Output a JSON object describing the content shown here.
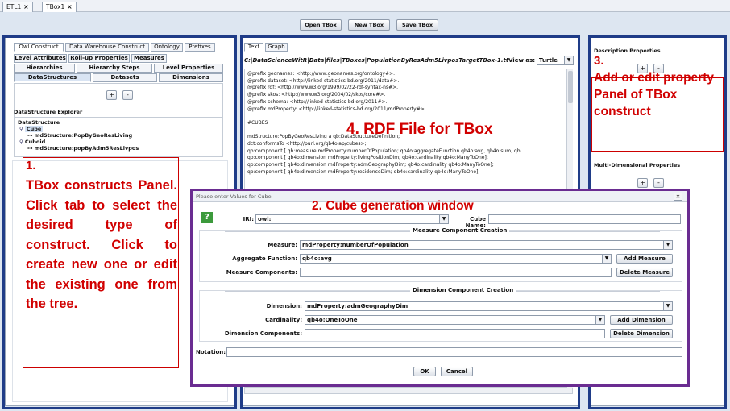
{
  "file_tabs": [
    {
      "label": "ETL1",
      "close": "×"
    },
    {
      "label": "TBox1",
      "close": "×"
    }
  ],
  "toolbar": {
    "open_label": "Open TBox",
    "new_label": "New TBox",
    "save_label": "Save TBox"
  },
  "left_panel": {
    "tabs_row1": [
      "Owl Construct",
      "Data Warehouse Construct",
      "Ontology",
      "Prefixes"
    ],
    "tabs_row2": [
      "Level Attributes",
      "Roll-up Properties",
      "Measures"
    ],
    "tabs_row3": [
      "Hierarchies",
      "Hierarchy Steps",
      "Level Properties"
    ],
    "tabs_row4": [
      "DataStructures",
      "Datasets",
      "Dimensions"
    ],
    "add_label": "+",
    "remove_label": "-",
    "explorer_title": "DataStructure Explorer",
    "tree": {
      "root": "DataStructure",
      "cube": "Cube",
      "cube_child": "mdStructure:PopByGeoResLiving",
      "cuboid": "Cuboid",
      "cuboid_child": "mdStructure:popByAdm5ResLivpos"
    }
  },
  "annotations": {
    "a1_num": "1.",
    "a1_text": "TBox constructs Panel. Click tab to select the desired type of construct. Click to create new one or edit the existing one from the tree.",
    "a2": "2. Cube generation window",
    "a3_num": "3.",
    "a3_text": "Add or edit property Panel of TBox construct",
    "a4": "4. RDF File for TBox"
  },
  "center_panel": {
    "tabs": [
      "Text",
      "Graph"
    ],
    "path": "C:|DataScienceWitR|Data|files|TBoxes|PopulationByResAdm5LivposTargetTBox-1.tt",
    "view_as_label": "View as:",
    "view_as_value": "Turtle",
    "lines": [
      "@prefix geonames: <http://www.geonames.org/ontology#>.",
      "@prefix dataset: <http://linked-statistics-bd.org/2011/data#>.",
      "@prefix rdf: <http://www.w3.org/1999/02/22-rdf-syntax-ns#>.",
      "@prefix skos: <http://www.w3.org/2004/02/skos/core#>.",
      "@prefix schema: <http://linked-statistics-bd.org/2011#>.",
      "@prefix mdProperty: <http://linked-statistics-bd.org/2011/mdProperty#>.",
      "",
      "#CUBES",
      "",
      "mdStructure:PopByGeoResLiving a qb:DataStructureDefinition;",
      "                                    dct:conformsTo <http://purl.org/qb4olap/cubes>;",
      "                                    qb:component [ qb:measure mdProperty:numberOfPopulation; qb4o:aggregateFunction qb4o:avg, qb4o:sum, qb",
      "                                    qb:component [ qb4o:dimension mdProperty:livingPositionDim; qb4o:cardinality qb4o:ManyToOne];",
      "                                    qb:component [ qb4o:dimension mdProperty:admGeographyDim; qb4o:cardinality qb4o:ManyToOne];",
      "                                    qb:component [ qb4o:dimension mdProperty:residenceDim; qb4o:cardinality qb4o:ManyToOne];"
    ]
  },
  "right_panel": {
    "desc_title": "Description Properties",
    "md_title": "Multi-Dimensional Properties",
    "add_label": "+",
    "remove_label": "-"
  },
  "dialog": {
    "title": "Please enter Values for Cube",
    "help_icon": "?",
    "close_icon": "✕",
    "iri_label": "IRI:",
    "iri_value": "owl:",
    "cube_name_label": "Cube Name:",
    "cube_name_value": "",
    "measure_section": "Measure Component Creation",
    "measure_label": "Measure:",
    "measure_value": "mdProperty:numberOfPopulation",
    "aggregate_label": "Aggregate Function:",
    "aggregate_value": "qb4o:avg",
    "add_measure_label": "Add Measure",
    "measure_components_label": "Measure Components:",
    "delete_measure_label": "Delete Measure",
    "dimension_section": "Dimension Component Creation",
    "dimension_label": "Dimension:",
    "dimension_value": "mdProperty:admGeographyDim",
    "cardinality_label": "Cardinality:",
    "cardinality_value": "qb4o:OneToOne",
    "add_dimension_label": "Add Dimension",
    "dimension_components_label": "Dimension Components:",
    "delete_dimension_label": "Delete Dimension",
    "notation_label": "Notation:",
    "ok_label": "OK",
    "cancel_label": "Cancel"
  },
  "colors": {
    "annotation_red": "#d10000",
    "panel_blue": "#1f3c88",
    "dialog_purple": "#6a2c91"
  }
}
